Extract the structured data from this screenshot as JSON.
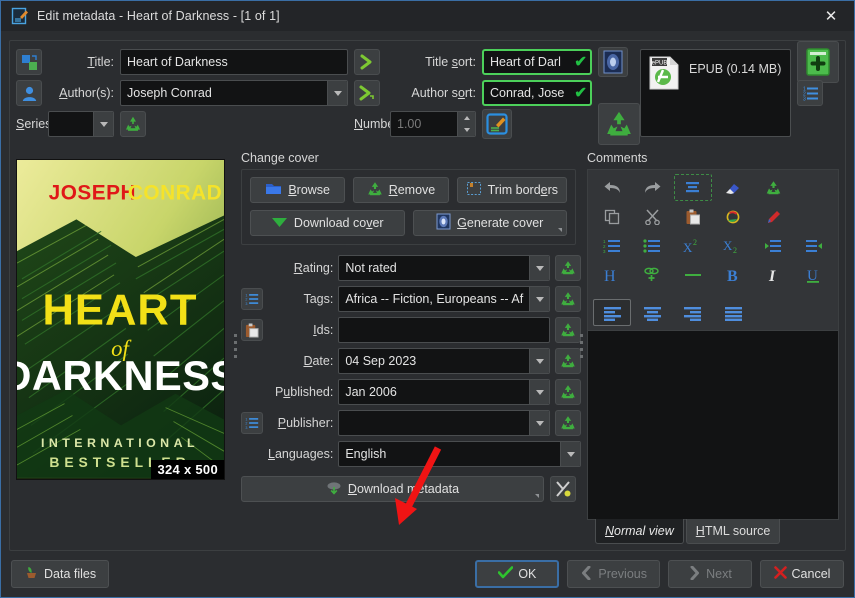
{
  "titlebar": {
    "icon": "edit-metadata-icon",
    "text": "Edit metadata - Heart of Darkness -  [1 of 1]",
    "close_label": "✕"
  },
  "fields": {
    "title_label": "Title:",
    "title_value": "Heart of Darkness",
    "authors_label": "Author(s):",
    "authors_value": "Joseph Conrad",
    "series_label": "Series:",
    "series_value": "",
    "title_sort_label": "Title sort:",
    "title_sort_value": "Heart of Darl",
    "author_sort_label": "Author sort:",
    "author_sort_value": "Conrad, Jose",
    "number_label": "Number:",
    "number_value": "1.00"
  },
  "formats": {
    "items": [
      {
        "name": "EPUB (0.14 MB)",
        "icon": "epub-file-icon"
      }
    ],
    "add_button": "add-format-button",
    "remove_button": "remove-format-button"
  },
  "cover": {
    "group_title": "Change cover",
    "size_badge": "324 x 500",
    "art": {
      "author_first": "JOSEPH",
      "author_last": "CONRAD",
      "title_line1": "HEART",
      "title_line2": "of",
      "title_line3": "DARKNESS",
      "tagline1": "INTERNATIONAL",
      "tagline2": "BESTSELLER"
    },
    "buttons": [
      {
        "label": "Browse",
        "accel": "B",
        "icon": "folder-open-icon"
      },
      {
        "label": "Remove",
        "accel": "R",
        "icon": "recycle-icon"
      },
      {
        "label": "Trim borders",
        "accel": "e",
        "icon": "crop-icon"
      },
      {
        "label": "Download cover",
        "accel": "v",
        "icon": "download-arrow-icon"
      },
      {
        "label": "Generate cover",
        "accel": "G",
        "icon": "generate-cover-icon"
      }
    ]
  },
  "meta": {
    "rows": [
      {
        "label": "Rating:",
        "accel": "R",
        "value": "Not rated",
        "kind": "combo",
        "left_icon": null,
        "reset": true,
        "placeholder": ""
      },
      {
        "label": "Tags:",
        "accel": "",
        "value": "Africa -- Fiction, Europeans -- Af",
        "kind": "combo",
        "left_icon": "tags-icon",
        "reset": true,
        "placeholder": ""
      },
      {
        "label": "Ids:",
        "accel": "I",
        "value": "",
        "kind": "text",
        "left_icon": "paste-icon",
        "reset": true,
        "placeholder": ""
      },
      {
        "label": "Date:",
        "accel": "D",
        "value": "04 Sep 2023",
        "kind": "combo",
        "left_icon": null,
        "reset": true,
        "placeholder": ""
      },
      {
        "label": "Published:",
        "accel": "u",
        "value": "Jan 2006",
        "kind": "combo",
        "left_icon": null,
        "reset": true,
        "placeholder": ""
      },
      {
        "label": "Publisher:",
        "accel": "P",
        "value": "",
        "kind": "combo",
        "left_icon": "publisher-icon",
        "reset": true,
        "placeholder": ""
      },
      {
        "label": "Languages:",
        "accel": "L",
        "value": "English",
        "kind": "combo",
        "left_icon": null,
        "reset": false,
        "placeholder": ""
      }
    ],
    "download_metadata_label": "Download metadata",
    "download_metadata_accel": "D",
    "config_button": "configure-metadata-download-button"
  },
  "comments": {
    "group_title": "Comments",
    "body": "",
    "toolbar": [
      "undo-icon",
      "redo-icon",
      "remove-formatting-icon",
      "erase-icon",
      "recycle-icon",
      "",
      "copy-icon",
      "cut-icon",
      "paste-icon",
      "background-color-icon",
      "foreground-color-icon",
      "",
      "ordered-list-icon",
      "unordered-list-icon",
      "superscript-icon",
      "subscript-icon",
      "indent-icon",
      "outdent-icon",
      "heading-icon",
      "insert-link-icon",
      "horizontal-rule-icon",
      "bold-icon",
      "italic-icon",
      "underline-icon",
      "strikethrough-icon",
      "align-left-icon",
      "align-center-icon",
      "align-right-icon",
      "align-justify-icon",
      ""
    ],
    "tabs": [
      {
        "label": "Normal view",
        "accel": "N",
        "active": true
      },
      {
        "label": "HTML source",
        "accel": "H",
        "active": false
      }
    ]
  },
  "footer": {
    "data_files": {
      "label": "Data files",
      "icon": "sprout-icon"
    },
    "ok": {
      "label": "OK",
      "icon": "check-icon",
      "enabled": true
    },
    "previous": {
      "label": "Previous",
      "icon": "chevron-left-icon",
      "enabled": false
    },
    "next": {
      "label": "Next",
      "icon": "chevron-right-icon",
      "enabled": false
    },
    "cancel": {
      "label": "Cancel",
      "icon": "cross-icon",
      "enabled": true
    }
  },
  "annotation": {
    "arrow_color": "#f01414",
    "points_to": "download-metadata-button"
  }
}
